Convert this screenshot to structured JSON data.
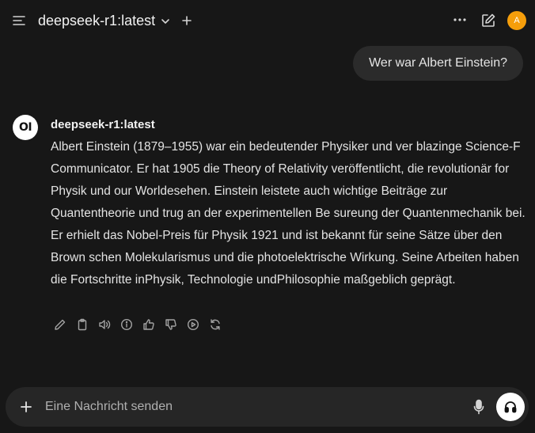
{
  "header": {
    "model_name": "deepseek-r1:latest",
    "avatar_initial": "A"
  },
  "user_message": {
    "text": "Wer war Albert Einstein?"
  },
  "assistant": {
    "logo_text": "OI",
    "name": "deepseek-r1:latest",
    "text": "Albert Einstein (1879–1955) war ein bedeutender Physiker und ver blazinge Science-F Communicator. Er hat 1905 die Theory of Relativity veröffentlicht, die revolutionär for Physik und our Worldesehen. Einstein leistete auch wichtige Beiträge zur Quantentheorie und trug an der experimentellen Be sureung der Quantenmechanik bei. Er erhielt das Nobel-Preis für Physik 1921 und ist bekannt für seine Sätze über den Brown schen Molekularismus und die photoelektrische Wirkung. Seine Arbeiten haben die Fortschritte inPhysik, Technologie undPhilosophie maßgeblich geprägt."
  },
  "actions": [
    "edit-icon",
    "copy-icon",
    "speaker-icon",
    "info-icon",
    "thumbs-up-icon",
    "thumbs-down-icon",
    "play-icon",
    "regenerate-icon"
  ],
  "input": {
    "placeholder": "Eine Nachricht senden",
    "value": ""
  },
  "colors": {
    "background": "#171717",
    "bubble": "#2b2b2b",
    "input_bar": "#262626",
    "avatar": "#f59e0b"
  }
}
